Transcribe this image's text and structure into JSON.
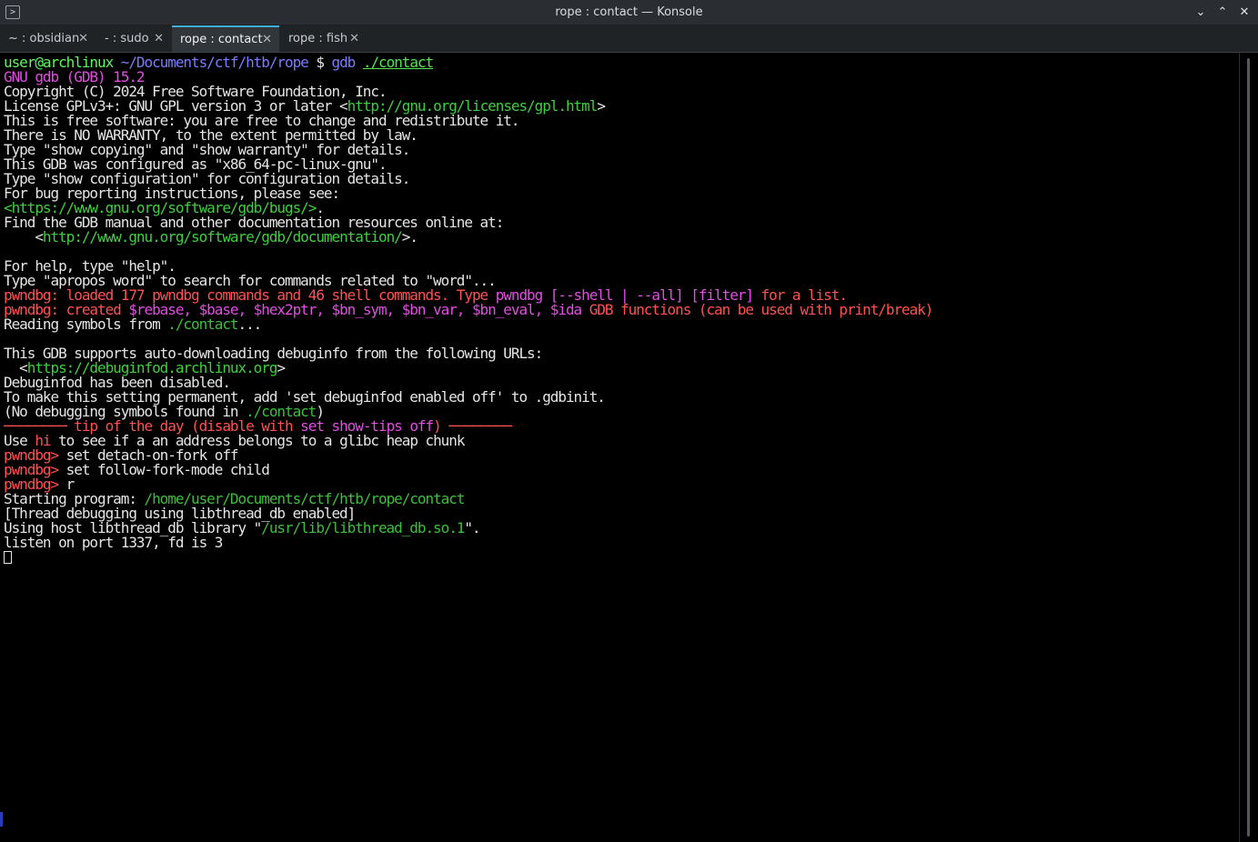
{
  "window": {
    "title": "rope : contact — Konsole",
    "app_icon_glyph": ">",
    "minimize_glyph": "⌄",
    "maximize_glyph": "⌃",
    "close_glyph": "✕"
  },
  "tabs": [
    {
      "label": "~ : obsidian",
      "active": false,
      "close_glyph": "✕"
    },
    {
      "label": "- : sudo",
      "active": false,
      "close_glyph": "✕"
    },
    {
      "label": "rope : contact",
      "active": true,
      "close_glyph": "✕"
    },
    {
      "label": "rope : fish",
      "active": false,
      "close_glyph": "✕"
    }
  ],
  "colors": {
    "accent": "#3daee9",
    "terminal_bg": "#000000",
    "prompt_user": "#5ff55f",
    "path_blue": "#7b7bff",
    "magenta": "#e34de3",
    "red": "#ff5151",
    "green": "#4ee54e"
  },
  "terminal": {
    "lines": [
      [
        {
          "t": "user@archlinux",
          "c": "c-user"
        },
        {
          "t": " ",
          "c": "c-def"
        },
        {
          "t": "~/Documents/ctf/htb/rope",
          "c": "c-blue"
        },
        {
          "t": " $ ",
          "c": "c-def"
        },
        {
          "t": "gdb",
          "c": "c-blue"
        },
        {
          "t": " ",
          "c": "c-def"
        },
        {
          "t": "./contact",
          "c": "c-green",
          "u": true
        }
      ],
      [
        {
          "t": "GNU gdb (GDB) 15.2",
          "c": "c-mag"
        }
      ],
      [
        {
          "t": "Copyright (C) 2024 Free Software Foundation, Inc.",
          "c": "c-def"
        }
      ],
      [
        {
          "t": "License GPLv3+: GNU GPL version 3 or later <",
          "c": "c-def"
        },
        {
          "t": "http://gnu.org/licenses/gpl.html",
          "c": "c-link"
        },
        {
          "t": ">",
          "c": "c-def"
        }
      ],
      [
        {
          "t": "This is free software: you are free to change and redistribute it.",
          "c": "c-def"
        }
      ],
      [
        {
          "t": "There is NO WARRANTY, to the extent permitted by law.",
          "c": "c-def"
        }
      ],
      [
        {
          "t": "Type \"show copying\" and \"show warranty\" for details.",
          "c": "c-def"
        }
      ],
      [
        {
          "t": "This GDB was configured as \"x86_64-pc-linux-gnu\".",
          "c": "c-def"
        }
      ],
      [
        {
          "t": "Type \"show configuration\" for configuration details.",
          "c": "c-def"
        }
      ],
      [
        {
          "t": "For bug reporting instructions, please see:",
          "c": "c-def"
        }
      ],
      [
        {
          "t": "<https://www.gnu.org/software/gdb/bugs/>",
          "c": "c-link"
        },
        {
          "t": ".",
          "c": "c-def"
        }
      ],
      [
        {
          "t": "Find the GDB manual and other documentation resources online at:",
          "c": "c-def"
        }
      ],
      [
        {
          "t": "    <",
          "c": "c-def"
        },
        {
          "t": "http://www.gnu.org/software/gdb/documentation/",
          "c": "c-link"
        },
        {
          "t": ">.",
          "c": "c-def"
        }
      ],
      [
        {
          "t": "",
          "c": "c-def"
        }
      ],
      [
        {
          "t": "For help, type \"help\".",
          "c": "c-def"
        }
      ],
      [
        {
          "t": "Type \"apropos word\" to search for commands related to \"word\"...",
          "c": "c-def"
        }
      ],
      [
        {
          "t": "pwndbg: loaded 177 pwndbg commands and 46 shell commands. Type ",
          "c": "c-red"
        },
        {
          "t": "pwndbg [--shell | --all] [filter]",
          "c": "c-mag"
        },
        {
          "t": " for a list.",
          "c": "c-red"
        }
      ],
      [
        {
          "t": "pwndbg: created ",
          "c": "c-red"
        },
        {
          "t": "$rebase, $base, $hex2ptr, $bn_sym, $bn_var, $bn_eval, $ida",
          "c": "c-mag"
        },
        {
          "t": " GDB functions (can be used with print/break)",
          "c": "c-red"
        }
      ],
      [
        {
          "t": "Reading symbols from ",
          "c": "c-def"
        },
        {
          "t": "./contact",
          "c": "c-dgreen"
        },
        {
          "t": "...",
          "c": "c-def"
        }
      ],
      [
        {
          "t": "",
          "c": "c-def"
        }
      ],
      [
        {
          "t": "This GDB supports auto-downloading debuginfo from the following URLs:",
          "c": "c-def"
        }
      ],
      [
        {
          "t": "  <",
          "c": "c-def"
        },
        {
          "t": "https://debuginfod.archlinux.org",
          "c": "c-link"
        },
        {
          "t": ">",
          "c": "c-def"
        }
      ],
      [
        {
          "t": "Debuginfod has been disabled.",
          "c": "c-def"
        }
      ],
      [
        {
          "t": "To make this setting permanent, add 'set debuginfod enabled off' to .gdbinit.",
          "c": "c-def"
        }
      ],
      [
        {
          "t": "(No debugging symbols found in ",
          "c": "c-def"
        },
        {
          "t": "./contact",
          "c": "c-dgreen"
        },
        {
          "t": ")",
          "c": "c-def"
        }
      ],
      [
        {
          "t": "──────── tip of the day (disable with ",
          "c": "c-red"
        },
        {
          "t": "set show-tips off",
          "c": "c-mag"
        },
        {
          "t": ") ────────",
          "c": "c-red"
        }
      ],
      [
        {
          "t": "Use ",
          "c": "c-def"
        },
        {
          "t": "hi",
          "c": "c-red"
        },
        {
          "t": " to see if a an address belongs to a glibc heap chunk",
          "c": "c-def"
        }
      ],
      [
        {
          "t": "pwndbg>",
          "c": "c-red"
        },
        {
          "t": " set detach-on-fork off",
          "c": "c-def"
        }
      ],
      [
        {
          "t": "pwndbg>",
          "c": "c-red"
        },
        {
          "t": " set follow-fork-mode child",
          "c": "c-def"
        }
      ],
      [
        {
          "t": "pwndbg>",
          "c": "c-red"
        },
        {
          "t": " r",
          "c": "c-def"
        }
      ],
      [
        {
          "t": "Starting program: ",
          "c": "c-def"
        },
        {
          "t": "/home/user/Documents/ctf/htb/rope/contact",
          "c": "c-dgreen"
        }
      ],
      [
        {
          "t": "[Thread debugging using libthread_db enabled]",
          "c": "c-def"
        }
      ],
      [
        {
          "t": "Using host libthread_db library \"",
          "c": "c-def"
        },
        {
          "t": "/usr/lib/libthread_db.so.1",
          "c": "c-dgreen"
        },
        {
          "t": "\".",
          "c": "c-def"
        }
      ],
      [
        {
          "t": "listen on port 1337, fd is 3",
          "c": "c-def"
        }
      ]
    ]
  }
}
